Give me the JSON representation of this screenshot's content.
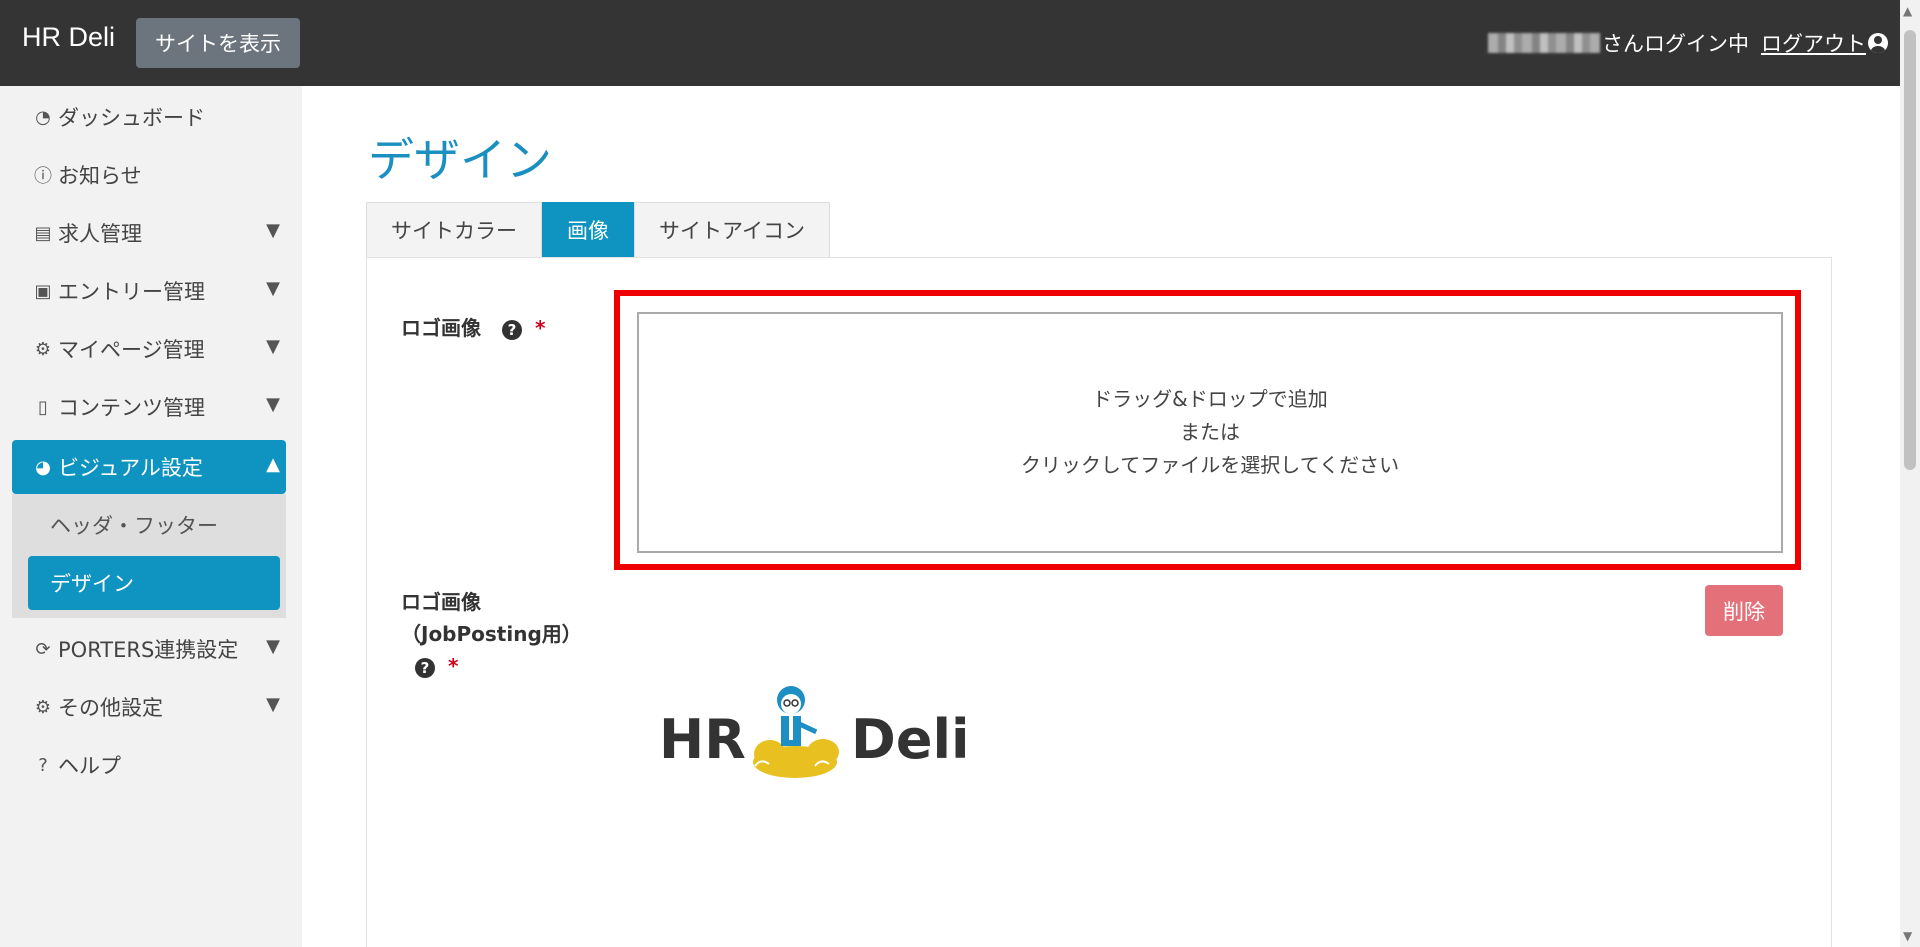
{
  "header": {
    "brand": "HR Deli",
    "view_site_label": "サイトを表示",
    "login_status": "さんログイン中",
    "logout_label": "ログアウト"
  },
  "sidebar": {
    "items": [
      {
        "label": "ダッシュボード",
        "icon": "gauge-icon"
      },
      {
        "label": "お知らせ",
        "icon": "info-icon"
      },
      {
        "label": "求人管理",
        "icon": "list-icon"
      },
      {
        "label": "エントリー管理",
        "icon": "id-card-icon"
      },
      {
        "label": "マイページ管理",
        "icon": "user-gear-icon"
      },
      {
        "label": "コンテンツ管理",
        "icon": "file-icon"
      },
      {
        "label": "ビジュアル設定",
        "icon": "palette-icon"
      },
      {
        "label": "PORTERS連携設定",
        "icon": "sync-icon"
      },
      {
        "label": "その他設定",
        "icon": "gear-icon"
      },
      {
        "label": "ヘルプ",
        "icon": "question-icon"
      }
    ],
    "subitems": [
      {
        "label": "ヘッダ・フッター"
      },
      {
        "label": "デザイン"
      }
    ]
  },
  "main": {
    "title": "デザイン",
    "tabs": [
      {
        "label": "サイトカラー"
      },
      {
        "label": "画像"
      },
      {
        "label": "サイトアイコン"
      }
    ],
    "logo_field": {
      "label": "ロゴ画像",
      "required_mark": "*",
      "dropzone_line1": "ドラッグ&ドロップで追加",
      "dropzone_line2": "または",
      "dropzone_line3": "クリックしてファイルを選択してください"
    },
    "jobposting_field": {
      "label_line1": "ロゴ画像",
      "label_line2": "（JobPosting用）",
      "required_mark": "*",
      "delete_label": "削除",
      "logo_text_left": "HR",
      "logo_text_right": "Deli"
    }
  },
  "colors": {
    "accent": "#0f94c1",
    "topbar": "#343434",
    "highlight": "#ee0000",
    "delete": "#e4707a"
  }
}
